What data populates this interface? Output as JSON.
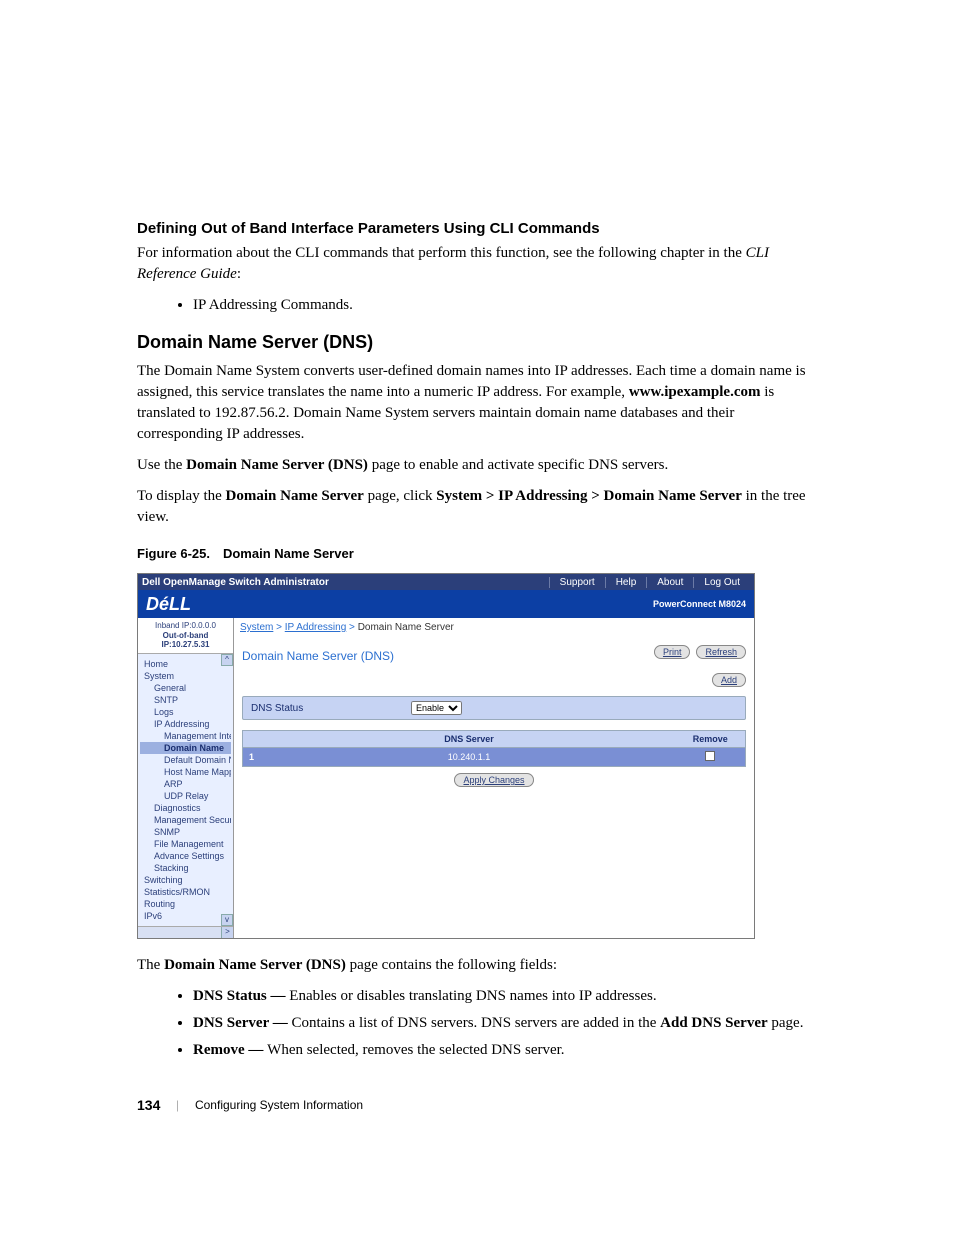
{
  "heading1": "Defining Out of Band Interface Parameters Using CLI Commands",
  "para1a": "For information about the CLI commands that perform this function, see the following chapter in the ",
  "para1b": "CLI Reference Guide",
  "para1c": ":",
  "bullet1": "IP Addressing Commands.",
  "heading2": "Domain Name Server (DNS)",
  "para2a": "The Domain Name System converts user-defined domain names into IP addresses. Each time a domain name is assigned, this service translates the name into a numeric IP address. For example, ",
  "para2b": "www.ipexample.com",
  "para2c": " is translated to 192.87.56.2. Domain Name System servers maintain domain name databases and their corresponding IP addresses.",
  "para3a": "Use the ",
  "para3b": "Domain Name Server (DNS)",
  "para3c": " page to enable and activate specific DNS servers.",
  "para4a": "To display the ",
  "para4b": "Domain Name Server",
  "para4c": " page, click ",
  "para4d": "System > IP Addressing > Domain Name Server",
  "para4e": " in the tree view.",
  "figcap": "Figure 6-25. Domain Name Server",
  "shot": {
    "topTitle": "Dell OpenManage Switch Administrator",
    "links": [
      "Support",
      "Help",
      "About",
      "Log Out"
    ],
    "logo": "DéLL",
    "product": "PowerConnect M8024",
    "ip1": "Inband IP:0.0.0.0",
    "ip2": "Out-of-band IP:10.27.5.31",
    "bc": {
      "a": "System",
      "b": "IP Addressing",
      "c": "Domain Name Server"
    },
    "panelTitle": "Domain Name Server (DNS)",
    "btnPrint": "Print",
    "btnRefresh": "Refresh",
    "btnAdd": "Add",
    "statusLabel": "DNS Status",
    "statusValue": "Enable",
    "thServer": "DNS Server",
    "thRemove": "Remove",
    "row1idx": "1",
    "row1val": "10.240.1.1",
    "applyBtn": "Apply Changes",
    "tree": {
      "home": "Home",
      "system": "System",
      "general": "General",
      "sntp": "SNTP",
      "logs": "Logs",
      "ipaddr": "IP Addressing",
      "mgmt": "Management Inte",
      "dns": "Domain Name",
      "def": "Default Domain N",
      "host": "Host Name Mapp",
      "arp": "ARP",
      "udp": "UDP Relay",
      "diag": "Diagnostics",
      "msec": "Management Secur",
      "snmp": "SNMP",
      "fmgmt": "File Management",
      "adv": "Advance Settings",
      "stack": "Stacking",
      "switch": "Switching",
      "stats": "Statistics/RMON",
      "routing": "Routing",
      "ipv6": "IPv6"
    }
  },
  "para5a": "The ",
  "para5b": "Domain Name Server (DNS)",
  "para5c": " page contains the following fields:",
  "f1a": "DNS Status — ",
  "f1b": "Enables or disables translating DNS names into IP addresses.",
  "f2a": "DNS Server — ",
  "f2b": "Contains a list of DNS servers. DNS servers are added in the ",
  "f2c": "Add DNS Server",
  "f2d": " page.",
  "f3a": "Remove — ",
  "f3b": "When selected, removes the selected DNS server.",
  "pageNum": "134",
  "footerSect": "Configuring System Information"
}
